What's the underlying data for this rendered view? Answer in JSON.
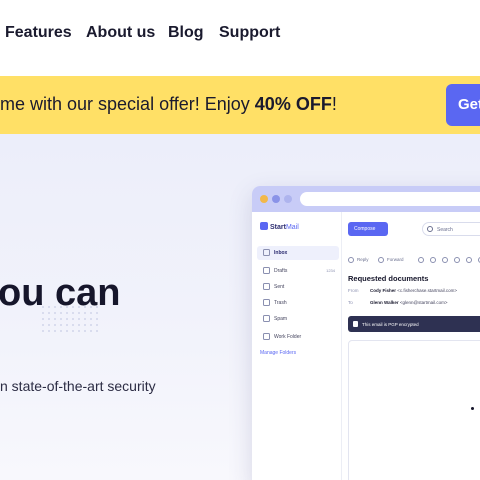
{
  "nav": {
    "links": [
      "Features",
      "About us",
      "Blog",
      "Support"
    ]
  },
  "promo": {
    "text_before": "me with our special offer! Enjoy ",
    "text_bold": "40% OFF",
    "text_after": "!",
    "button_label": "Get"
  },
  "hero": {
    "title": "ou can",
    "subtitle": "n state-of-the-art security"
  },
  "app": {
    "logo_start": "Start",
    "logo_mail": "Mail",
    "sidebar": [
      {
        "label": "Inbox",
        "count": "",
        "icon": "inbox-icon"
      },
      {
        "label": "Drafts",
        "count": "1234",
        "icon": "drafts-icon"
      },
      {
        "label": "Sent",
        "count": "",
        "icon": "send-icon"
      },
      {
        "label": "Trash",
        "count": "",
        "icon": "trash-icon"
      },
      {
        "label": "Spam",
        "count": "",
        "icon": "spam-icon"
      },
      {
        "label": "Work Folder",
        "count": "",
        "icon": "folder-icon"
      }
    ],
    "manage_folders": "Manage Folders",
    "compose_label": "Compose",
    "search_placeholder": "Search",
    "toolbar": {
      "reply": "Reply",
      "forward": "Forward"
    },
    "email": {
      "subject": "Requested documents",
      "from_key": "From",
      "from_name": "Cody Fisher",
      "from_addr": "<c.fisherchase.startmail.com>",
      "to_key": "To",
      "to_name": "Glenn Walker",
      "to_addr": "<glenn@startmail.com>",
      "pgp_notice": "This email is PGP encrypted"
    }
  },
  "colors": {
    "accent": "#5a67f2",
    "promo_bg": "#ffe066",
    "hero_bg": "#eceefa"
  }
}
